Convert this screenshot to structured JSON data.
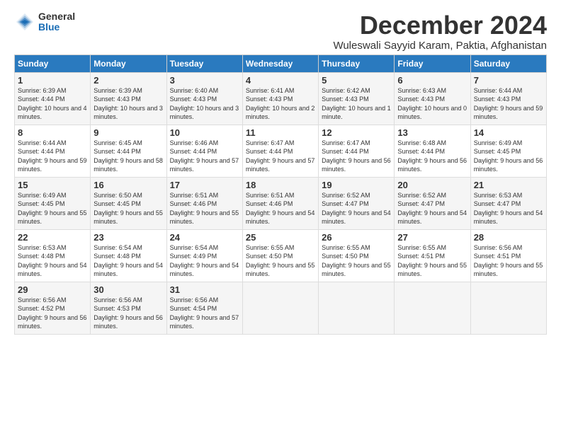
{
  "logo": {
    "general": "General",
    "blue": "Blue"
  },
  "title": "December 2024",
  "location": "Wuleswali Sayyid Karam, Paktia, Afghanistan",
  "days_of_week": [
    "Sunday",
    "Monday",
    "Tuesday",
    "Wednesday",
    "Thursday",
    "Friday",
    "Saturday"
  ],
  "weeks": [
    [
      {
        "day": "1",
        "sunrise": "6:39 AM",
        "sunset": "4:44 PM",
        "daylight": "10 hours and 4 minutes."
      },
      {
        "day": "2",
        "sunrise": "6:39 AM",
        "sunset": "4:43 PM",
        "daylight": "10 hours and 3 minutes."
      },
      {
        "day": "3",
        "sunrise": "6:40 AM",
        "sunset": "4:43 PM",
        "daylight": "10 hours and 3 minutes."
      },
      {
        "day": "4",
        "sunrise": "6:41 AM",
        "sunset": "4:43 PM",
        "daylight": "10 hours and 2 minutes."
      },
      {
        "day": "5",
        "sunrise": "6:42 AM",
        "sunset": "4:43 PM",
        "daylight": "10 hours and 1 minute."
      },
      {
        "day": "6",
        "sunrise": "6:43 AM",
        "sunset": "4:43 PM",
        "daylight": "10 hours and 0 minutes."
      },
      {
        "day": "7",
        "sunrise": "6:44 AM",
        "sunset": "4:43 PM",
        "daylight": "9 hours and 59 minutes."
      }
    ],
    [
      {
        "day": "8",
        "sunrise": "6:44 AM",
        "sunset": "4:44 PM",
        "daylight": "9 hours and 59 minutes."
      },
      {
        "day": "9",
        "sunrise": "6:45 AM",
        "sunset": "4:44 PM",
        "daylight": "9 hours and 58 minutes."
      },
      {
        "day": "10",
        "sunrise": "6:46 AM",
        "sunset": "4:44 PM",
        "daylight": "9 hours and 57 minutes."
      },
      {
        "day": "11",
        "sunrise": "6:47 AM",
        "sunset": "4:44 PM",
        "daylight": "9 hours and 57 minutes."
      },
      {
        "day": "12",
        "sunrise": "6:47 AM",
        "sunset": "4:44 PM",
        "daylight": "9 hours and 56 minutes."
      },
      {
        "day": "13",
        "sunrise": "6:48 AM",
        "sunset": "4:44 PM",
        "daylight": "9 hours and 56 minutes."
      },
      {
        "day": "14",
        "sunrise": "6:49 AM",
        "sunset": "4:45 PM",
        "daylight": "9 hours and 56 minutes."
      }
    ],
    [
      {
        "day": "15",
        "sunrise": "6:49 AM",
        "sunset": "4:45 PM",
        "daylight": "9 hours and 55 minutes."
      },
      {
        "day": "16",
        "sunrise": "6:50 AM",
        "sunset": "4:45 PM",
        "daylight": "9 hours and 55 minutes."
      },
      {
        "day": "17",
        "sunrise": "6:51 AM",
        "sunset": "4:46 PM",
        "daylight": "9 hours and 55 minutes."
      },
      {
        "day": "18",
        "sunrise": "6:51 AM",
        "sunset": "4:46 PM",
        "daylight": "9 hours and 54 minutes."
      },
      {
        "day": "19",
        "sunrise": "6:52 AM",
        "sunset": "4:47 PM",
        "daylight": "9 hours and 54 minutes."
      },
      {
        "day": "20",
        "sunrise": "6:52 AM",
        "sunset": "4:47 PM",
        "daylight": "9 hours and 54 minutes."
      },
      {
        "day": "21",
        "sunrise": "6:53 AM",
        "sunset": "4:47 PM",
        "daylight": "9 hours and 54 minutes."
      }
    ],
    [
      {
        "day": "22",
        "sunrise": "6:53 AM",
        "sunset": "4:48 PM",
        "daylight": "9 hours and 54 minutes."
      },
      {
        "day": "23",
        "sunrise": "6:54 AM",
        "sunset": "4:48 PM",
        "daylight": "9 hours and 54 minutes."
      },
      {
        "day": "24",
        "sunrise": "6:54 AM",
        "sunset": "4:49 PM",
        "daylight": "9 hours and 54 minutes."
      },
      {
        "day": "25",
        "sunrise": "6:55 AM",
        "sunset": "4:50 PM",
        "daylight": "9 hours and 55 minutes."
      },
      {
        "day": "26",
        "sunrise": "6:55 AM",
        "sunset": "4:50 PM",
        "daylight": "9 hours and 55 minutes."
      },
      {
        "day": "27",
        "sunrise": "6:55 AM",
        "sunset": "4:51 PM",
        "daylight": "9 hours and 55 minutes."
      },
      {
        "day": "28",
        "sunrise": "6:56 AM",
        "sunset": "4:51 PM",
        "daylight": "9 hours and 55 minutes."
      }
    ],
    [
      {
        "day": "29",
        "sunrise": "6:56 AM",
        "sunset": "4:52 PM",
        "daylight": "9 hours and 56 minutes."
      },
      {
        "day": "30",
        "sunrise": "6:56 AM",
        "sunset": "4:53 PM",
        "daylight": "9 hours and 56 minutes."
      },
      {
        "day": "31",
        "sunrise": "6:56 AM",
        "sunset": "4:54 PM",
        "daylight": "9 hours and 57 minutes."
      },
      null,
      null,
      null,
      null
    ]
  ]
}
